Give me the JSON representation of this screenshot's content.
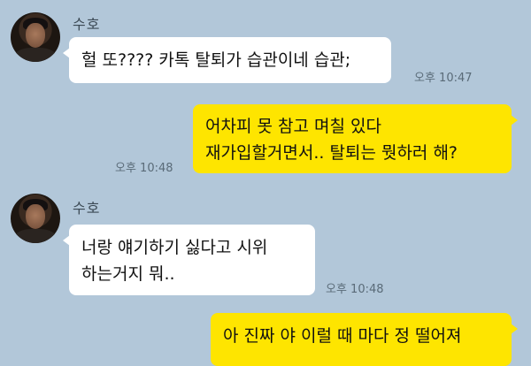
{
  "messages": [
    {
      "sender": "수호",
      "direction": "incoming",
      "lines": [
        "헐 또???? 카톡 탈퇴가 습관이네 습관;"
      ],
      "time": "오후 10:47"
    },
    {
      "direction": "outgoing",
      "lines": [
        "어차피 못 참고 며칠 있다",
        "재가입할거면서.. 탈퇴는 뭣하러 해?"
      ],
      "time": "오후 10:48"
    },
    {
      "sender": "수호",
      "direction": "incoming",
      "lines": [
        "너랑 얘기하기 싫다고 시위",
        "하는거지 뭐.."
      ],
      "time": "오후 10:48"
    },
    {
      "direction": "outgoing",
      "lines": [
        "아 진짜 야 이럴 때 마다 정 떨어져"
      ]
    }
  ],
  "colors": {
    "background": "#b2c7d9",
    "incoming_bubble": "#ffffff",
    "outgoing_bubble": "#fee500"
  }
}
